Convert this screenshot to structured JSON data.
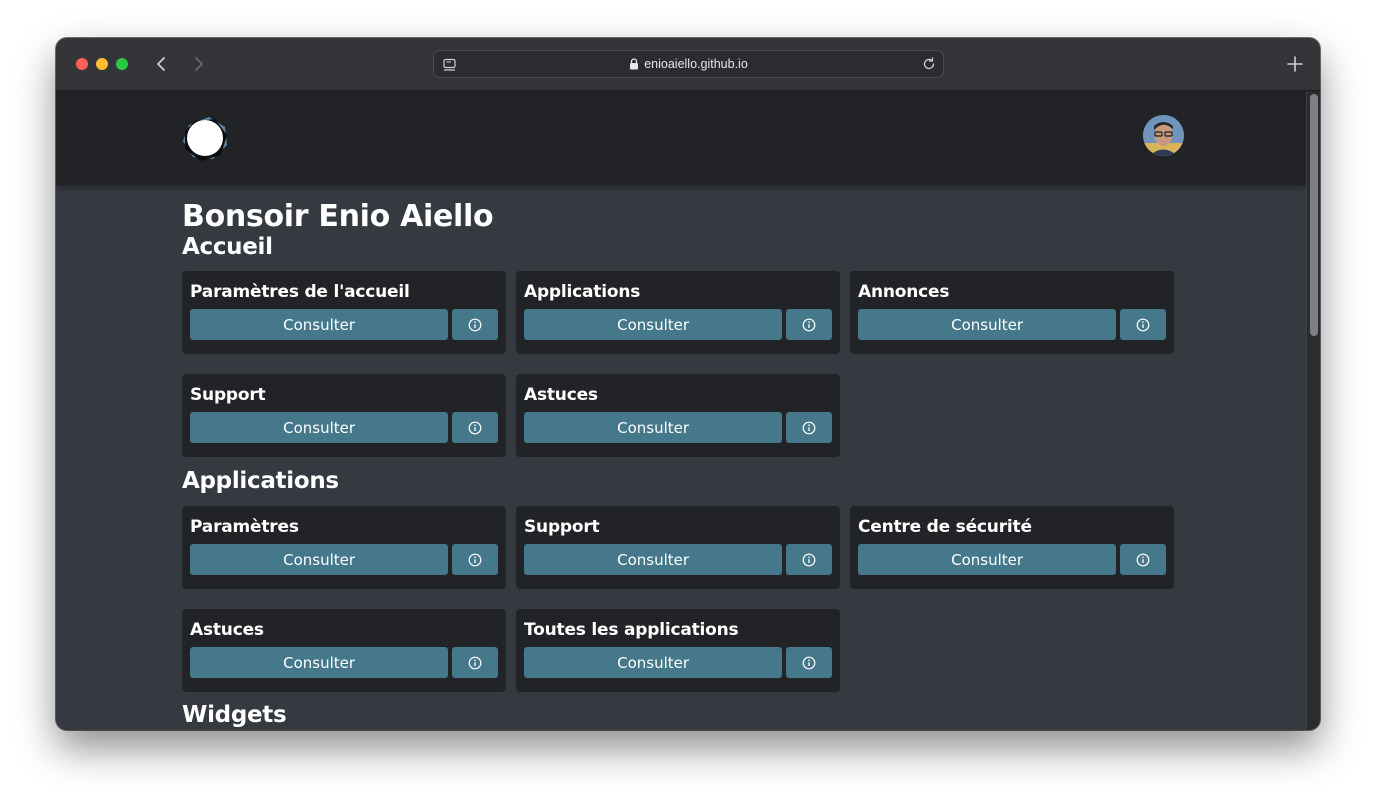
{
  "browser": {
    "url": "enioaiello.github.io"
  },
  "page": {
    "greeting": "Bonsoir Enio Aiello",
    "sections": [
      {
        "title": "Accueil",
        "cards": [
          {
            "title": "Paramètres de l'accueil",
            "button": "Consulter"
          },
          {
            "title": "Applications",
            "button": "Consulter"
          },
          {
            "title": "Annonces",
            "button": "Consulter"
          },
          {
            "title": "Support",
            "button": "Consulter"
          },
          {
            "title": "Astuces",
            "button": "Consulter"
          }
        ]
      },
      {
        "title": "Applications",
        "cards": [
          {
            "title": "Paramètres",
            "button": "Consulter"
          },
          {
            "title": "Support",
            "button": "Consulter"
          },
          {
            "title": "Centre de sécurité",
            "button": "Consulter"
          },
          {
            "title": "Astuces",
            "button": "Consulter"
          },
          {
            "title": "Toutes les applications",
            "button": "Consulter"
          }
        ]
      },
      {
        "title": "Widgets",
        "cards": []
      }
    ]
  },
  "colors": {
    "header_bg": "#212327",
    "page_bg": "#353940",
    "card_bg": "#212327",
    "button_bg": "#44788a"
  },
  "icons": {
    "info": "info-circle-icon",
    "lock": "lock-icon",
    "back": "chevron-left-icon",
    "forward": "chevron-right-icon",
    "reload": "reload-icon",
    "new_tab": "plus-icon",
    "sidebar": "sidebar-icon"
  }
}
